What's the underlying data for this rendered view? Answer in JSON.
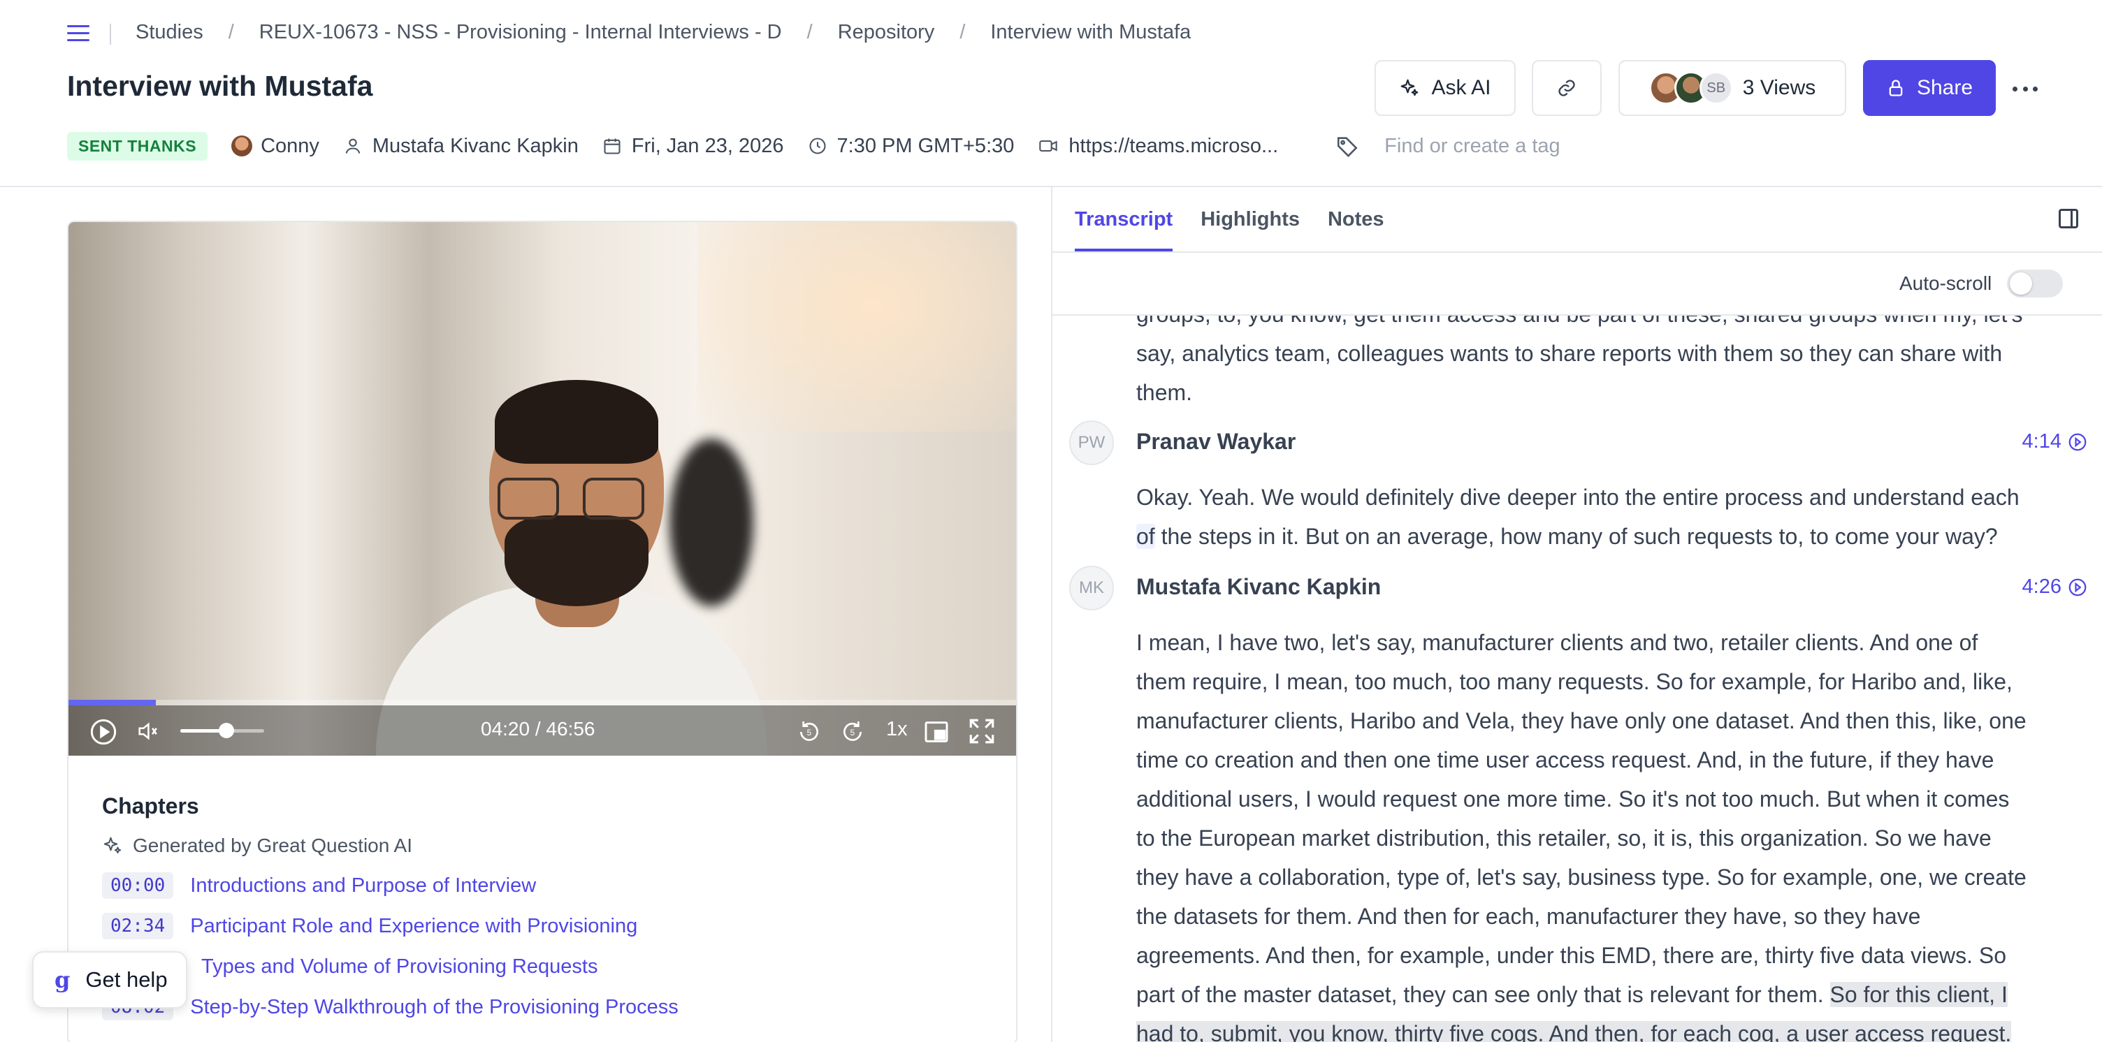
{
  "breadcrumb": [
    "Studies",
    "REUX-10673 - NSS - Provisioning - Internal Interviews - D",
    "Repository",
    "Interview with Mustafa"
  ],
  "page_title": "Interview with Mustafa",
  "actions": {
    "ask_ai": "Ask AI",
    "views": "3 Views",
    "viewer_initials": "SB",
    "share": "Share"
  },
  "meta": {
    "status_badge": "SENT THANKS",
    "owner": "Conny",
    "participant": "Mustafa Kivanc Kapkin",
    "date": "Fri, Jan 23, 2026",
    "time": "7:30 PM GMT+5:30",
    "meeting_link": "https://teams.microso...",
    "tag_placeholder": "Find or create a tag"
  },
  "player": {
    "time": "04:20 / 46:56",
    "speed": "1x",
    "progress": 0.092,
    "volume": 0.55
  },
  "chapters": {
    "title": "Chapters",
    "generated_by": "Generated by Great Question AI",
    "items": [
      {
        "time": "00:00",
        "title": "Introductions and Purpose of Interview"
      },
      {
        "time": "02:34",
        "title": "Participant Role and Experience with Provisioning"
      },
      {
        "time": "",
        "title": "Types and Volume of Provisioning Requests"
      },
      {
        "time": "08:02",
        "title": "Step-by-Step Walkthrough of the Provisioning Process"
      }
    ]
  },
  "help": {
    "label": "Get help"
  },
  "tabs": [
    "Transcript",
    "Highlights",
    "Notes"
  ],
  "autoscroll": {
    "label": "Auto-scroll",
    "on": false
  },
  "transcript": {
    "top_lines": [
      "groups, to, you know, get them access and be part of these, shared groups when my, let's",
      "say, analytics team, colleagues wants to share reports with them so they can share with",
      "them."
    ],
    "entries": [
      {
        "initials": "PW",
        "speaker": "Pranav Waykar",
        "timestamp": "4:14",
        "lines": [
          "Okay. Yeah. We would definitely dive deeper into the entire process and understand each",
          "the steps in it. But on an average, how many of such requests to, to come your way?"
        ],
        "highlighted_word": "of"
      },
      {
        "initials": "MK",
        "speaker": "Mustafa Kivanc Kapkin",
        "timestamp": "4:26",
        "lines": [
          "I mean, I have two, let's say, manufacturer clients and two, retailer clients. And one of",
          "them require, I mean, too much, too many requests. So for example, for Haribo and, like,",
          "manufacturer clients, Haribo and Vela, they have only one dataset. And then this, like, one",
          "time co creation and then one time user access request. And, in the future, if they have",
          "additional users, I would request one more time. So it's not too much. But when it comes",
          "to the European market distribution, this retailer, so, it is, this organization. So we have",
          "they have a collaboration, type of, let's say, business type. So for example, one, we create",
          "the datasets for them. And then for each, manufacturer they have, so they have",
          "agreements. And then, for example, under this EMD, there are, thirty five data views. So",
          "part of the master dataset, they can see only that is relevant for them."
        ],
        "highlight_tail": "So for this client, I",
        "highlight_line": "had to, submit, you know, thirty five cogs. And then, for each cog, a user access request."
      }
    ]
  }
}
